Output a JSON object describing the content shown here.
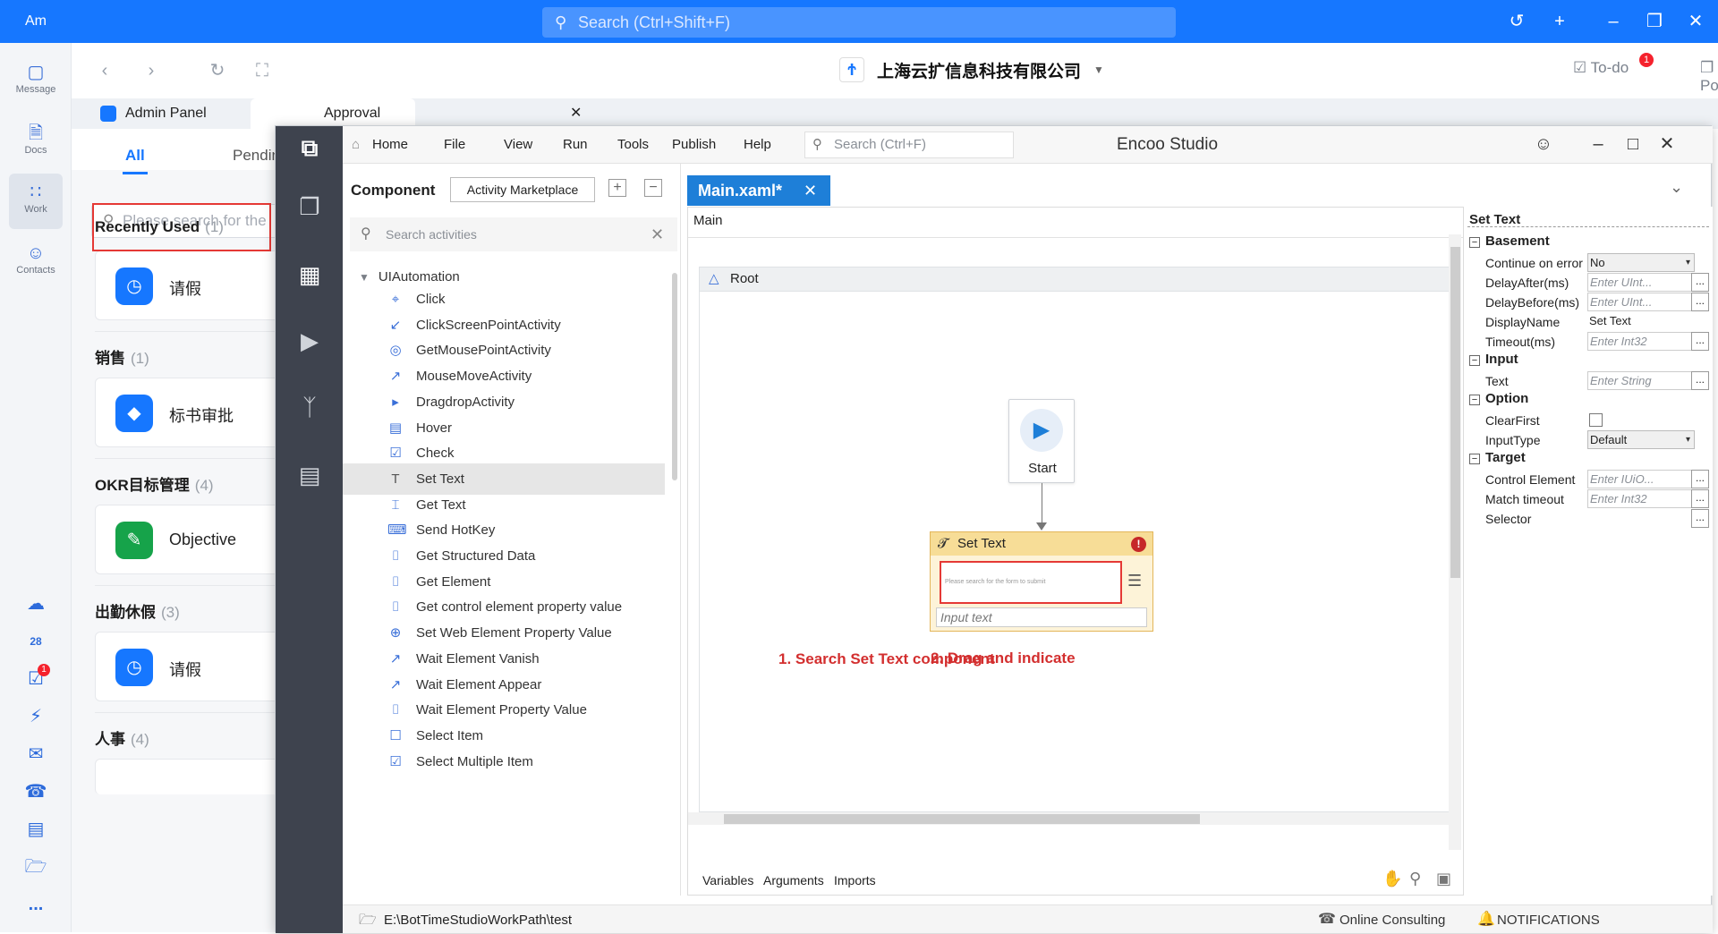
{
  "topbar": {
    "avatar_text": "Am",
    "search_placeholder": "Search (Ctrl+Shift+F)",
    "icons": [
      "search-icon",
      "history-icon",
      "plus-icon",
      "minimize-icon",
      "restore-icon",
      "close-icon"
    ]
  },
  "sidebar": {
    "items": [
      {
        "label": "Message",
        "icon": "message-icon"
      },
      {
        "label": "Docs",
        "icon": "docs-icon"
      },
      {
        "label": "Work",
        "icon": "grid-icon"
      },
      {
        "label": "Contacts",
        "icon": "contacts-icon"
      }
    ],
    "bottom_icons": [
      "cloud-icon",
      "calendar-icon",
      "todo-icon",
      "lightning-icon",
      "mail-icon",
      "phone-icon",
      "tasks-icon",
      "folder-icon",
      "more-icon"
    ],
    "calendar_day": "28",
    "todo_badge": "1",
    "more_label": "..."
  },
  "navbar": {
    "company": "上海云扩信息科技有限公司",
    "todo_label": "To-do",
    "todo_badge": "1",
    "popup_label": "Popup..."
  },
  "outer_tabs": [
    {
      "label": "Admin Panel"
    },
    {
      "label": "Approval",
      "active": true
    }
  ],
  "approval": {
    "tab_all": "All",
    "tab_pending": "Pendin",
    "search_placeholder": "Please search for the",
    "sections": [
      {
        "title": "Recently Used",
        "count": "(1)",
        "item": "请假",
        "color": "#1677ff"
      },
      {
        "title": "销售",
        "count": "(1)",
        "item": "标书审批",
        "color": "#1677ff"
      },
      {
        "title": "OKR目标管理",
        "count": "(4)",
        "item": "Objective",
        "color": "#16a34a"
      },
      {
        "title": "出勤休假",
        "count": "(3)",
        "item": "请假",
        "color": "#1677ff"
      },
      {
        "title": "人事",
        "count": "(4)"
      }
    ]
  },
  "studio": {
    "title": "Encoo Studio",
    "menu": [
      "Home",
      "File",
      "View",
      "Run",
      "Tools",
      "Publish",
      "Help"
    ],
    "search_placeholder": "Search  (Ctrl+F)",
    "component": {
      "title": "Component",
      "marketplace_button": "Activity Marketplace",
      "search_placeholder": "Search activities",
      "group": "UIAutomation",
      "activities": [
        "Click",
        "ClickScreenPointActivity",
        "GetMousePointActivity",
        "MouseMoveActivity",
        "DragdropActivity",
        "Hover",
        "Check",
        "Set Text",
        "Get Text",
        "Send HotKey",
        "Get Structured Data",
        "Get Element",
        "Get control element property value",
        "Set Web Element Property Value",
        "Wait Element Vanish",
        "Wait Element Appear",
        "Wait Element Property Value",
        "Select Item",
        "Select Multiple Item"
      ],
      "selected": "Set Text"
    },
    "annotation_1": "1. Search Set Text component",
    "annotation_2": "2. Drag and indicate",
    "designer": {
      "tab": "Main.xaml*",
      "breadcrumb": "Main",
      "root": "Root",
      "start_label": "Start",
      "node_title": "Set Text",
      "node_error": "!",
      "node_preview": "Please search for the form to submit",
      "node_input_placeholder": "Input text",
      "footer_tabs": [
        "Variables",
        "Arguments",
        "Imports"
      ]
    },
    "properties": {
      "title": "Set Text",
      "groups": [
        {
          "name": "Basement",
          "rows": [
            {
              "label": "Continue on error",
              "value": "No",
              "kind": "select"
            },
            {
              "label": "DelayAfter(ms)",
              "value": "Enter UInt...",
              "kind": "input"
            },
            {
              "label": "DelayBefore(ms)",
              "value": "Enter UInt...",
              "kind": "input"
            },
            {
              "label": "DisplayName",
              "value": "Set Text",
              "kind": "text"
            },
            {
              "label": "Timeout(ms)",
              "value": "Enter Int32",
              "kind": "input"
            }
          ]
        },
        {
          "name": "Input",
          "rows": [
            {
              "label": "Text",
              "value": "Enter String",
              "kind": "input"
            }
          ]
        },
        {
          "name": "Option",
          "rows": [
            {
              "label": "ClearFirst",
              "value": "",
              "kind": "checkbox"
            },
            {
              "label": "InputType",
              "value": "Default",
              "kind": "select"
            }
          ]
        },
        {
          "name": "Target",
          "rows": [
            {
              "label": "Control Element",
              "value": "Enter IUiO...",
              "kind": "input"
            },
            {
              "label": "Match timeout",
              "value": "Enter Int32",
              "kind": "input"
            },
            {
              "label": "Selector",
              "value": "",
              "kind": "dots"
            }
          ]
        }
      ]
    },
    "status": {
      "path": "E:\\BotTimeStudioWorkPath\\test",
      "consult": "Online Consulting",
      "notifications": "NOTIFICATIONS"
    }
  },
  "colors": {
    "topbar": "#1677ff",
    "rail": "#3e434e",
    "doc_tab": "#1e7fd8",
    "annotation": "#d32f2f",
    "highlight": "#e53935"
  }
}
